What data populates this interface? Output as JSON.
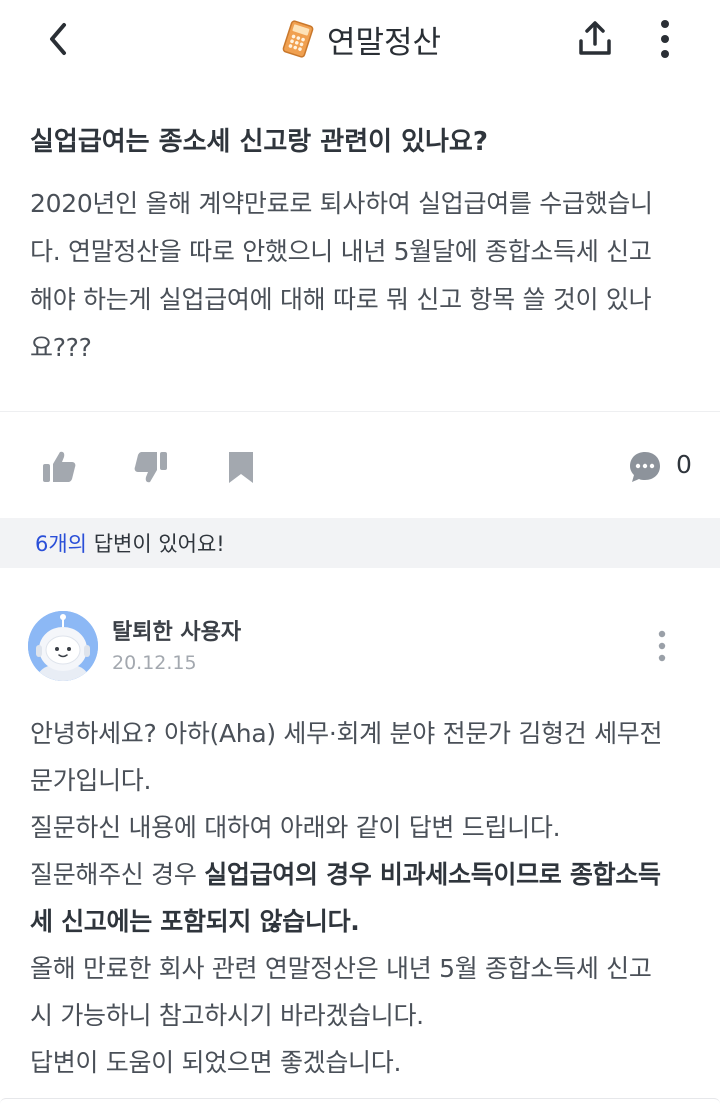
{
  "header": {
    "title": "연말정산",
    "icons": {
      "back": "back-arrow-icon",
      "logo": "calculator-icon",
      "share": "share-icon",
      "more": "more-vertical-icon"
    }
  },
  "question": {
    "title": "실업급여는 종소세 신고랑 관련이 있나요?",
    "lines": [
      "2020년인 올해 계약만료로 퇴사하여 실업급여를 수급했습니",
      "다. 연말정산을 따로 안했으니 내년 5월달에 종합소득세 신고",
      "해야 하는게 실업급여에 대해 따로 뭐 신고 항목 쓸 것이 있나",
      "요???"
    ]
  },
  "actions": {
    "icons": {
      "like": "thumbs-up-icon",
      "dislike": "thumbs-down-icon",
      "bookmark": "bookmark-icon",
      "comment": "comment-icon"
    },
    "comment_count": "0"
  },
  "answers_bar": {
    "count_text": "6개의",
    "rest_text": " 답변이 있어요!"
  },
  "answer": {
    "author": "탈퇴한 사용자",
    "date": "20.12.15",
    "lines": {
      "l1": "안녕하세요? 아하(Aha) 세무·회계 분야 전문가 김형건 세무전",
      "l2": "문가입니다.",
      "l3": "질문하신 내용에 대하여 아래와 같이 답변 드립니다.",
      "l4_normal": "질문해주신 경우 ",
      "l4_bold": "실업급여의 경우 비과세소득이므로 종합소득",
      "l5_bold": "세 신고에는 포함되지 않습니다.",
      "l6": "올해 만료한 회사 관련 연말정산은 내년 5월 종합소득세 신고",
      "l7": "시 가능하니 참고하시기 바라겠습니다.",
      "l8": "답변이 도움이 되었으면 좋겠습니다."
    }
  },
  "colors": {
    "accent": "#2a4fd8",
    "icon_gray": "#9aa0a8",
    "bar_bg": "#f2f3f5"
  }
}
